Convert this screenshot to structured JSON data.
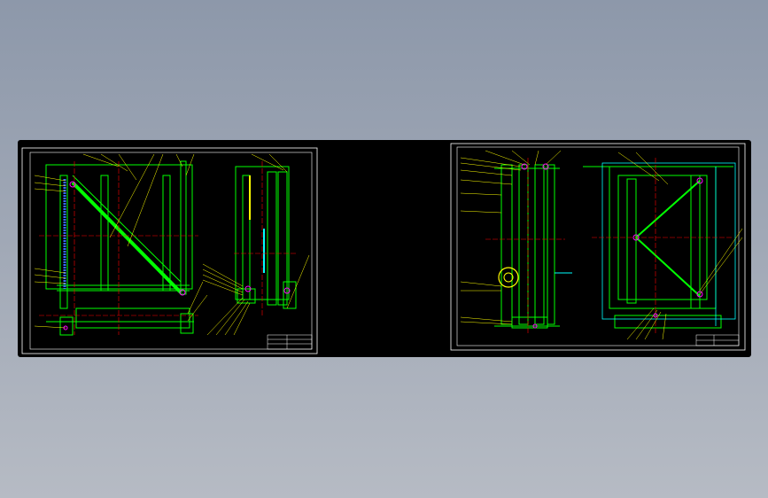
{
  "viewer": {
    "background_top": "#8d98aa",
    "background_bottom": "#b6bbc4",
    "canvas_color": "#000000"
  },
  "drawings": [
    {
      "name": "sheet-left",
      "palette": [
        "#ffffff",
        "#00ff00",
        "#ffff00",
        "#ff0000",
        "#00ffff",
        "#ff00ff"
      ]
    },
    {
      "name": "sheet-right",
      "palette": [
        "#ffffff",
        "#00ff00",
        "#ffff00",
        "#ff0000",
        "#00ffff",
        "#ff00ff"
      ]
    }
  ],
  "icons": [
    "cad-drawing-sheet-icon"
  ]
}
